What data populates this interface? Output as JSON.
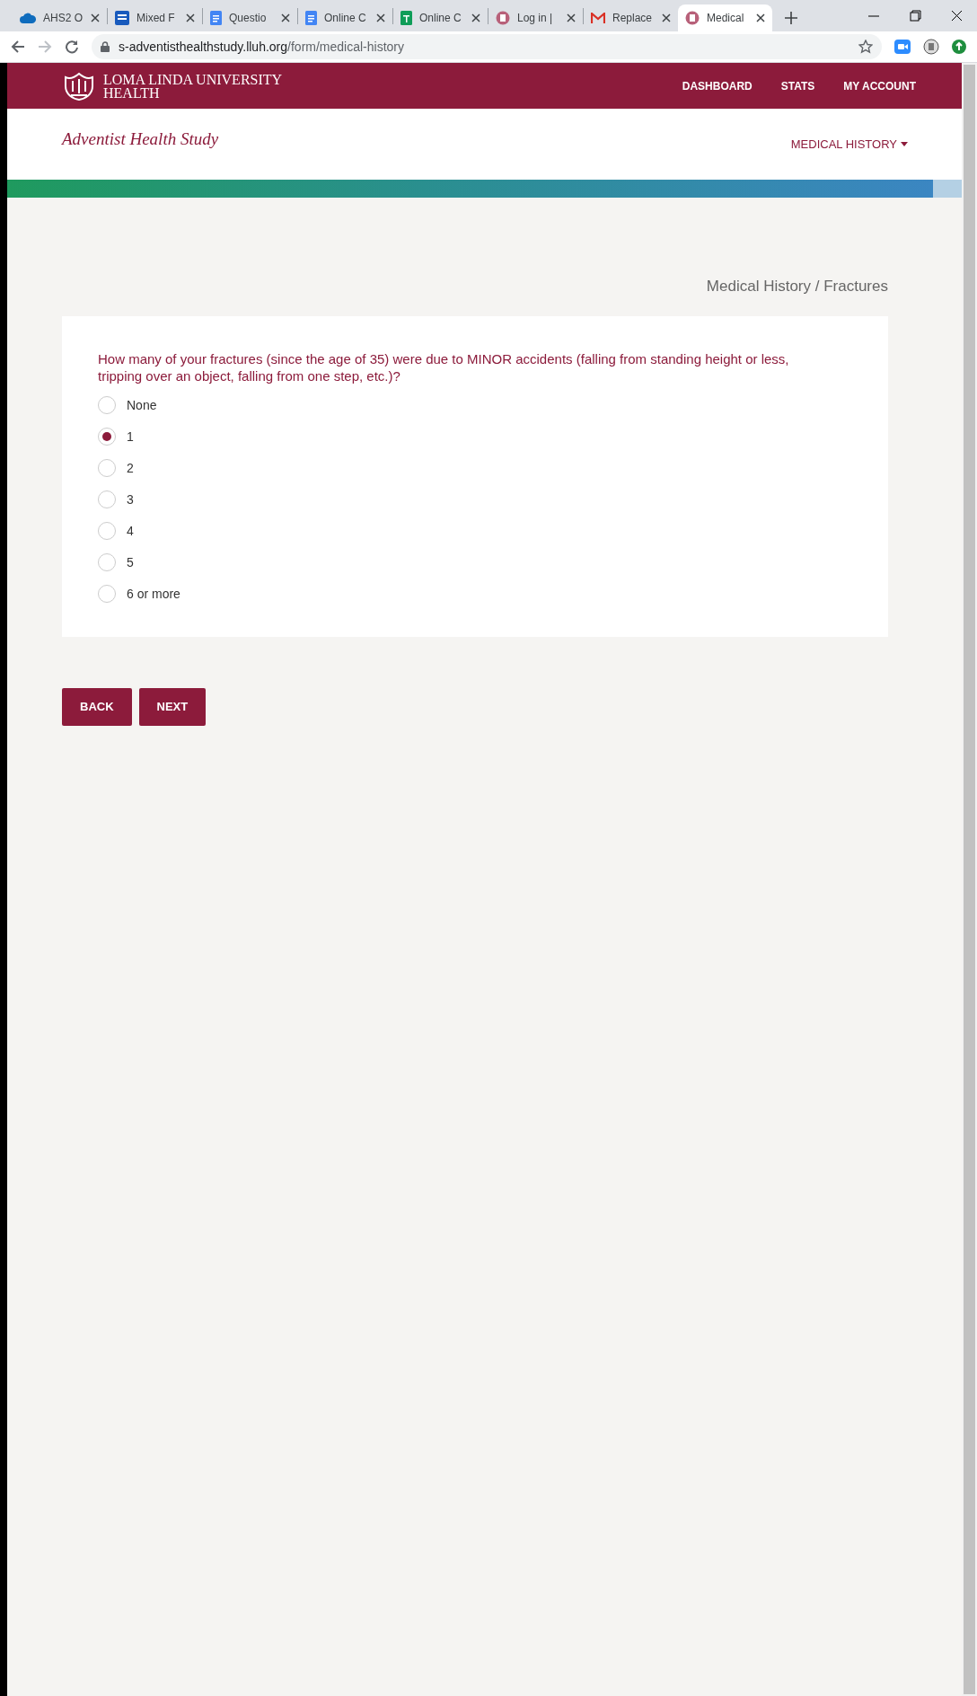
{
  "browser": {
    "tabs": [
      {
        "title": "AHS2 O",
        "kind": "cloud",
        "selected": false
      },
      {
        "title": "Mixed F",
        "kind": "word",
        "selected": false
      },
      {
        "title": "Questio",
        "kind": "doc",
        "selected": false
      },
      {
        "title": "Online C",
        "kind": "doc",
        "selected": false
      },
      {
        "title": "Online C",
        "kind": "sheet",
        "selected": false
      },
      {
        "title": "Log in |",
        "kind": "crest",
        "selected": false
      },
      {
        "title": "Replace",
        "kind": "mail",
        "selected": false
      },
      {
        "title": "Medical",
        "kind": "crest",
        "selected": true
      }
    ],
    "address": {
      "host": "s-adventisthealthstudy.lluh.org",
      "path": "/form/medical-history"
    }
  },
  "header": {
    "logo_lines": [
      "LOMA LINDA UNIVERSITY",
      "HEALTH"
    ],
    "nav": [
      "DASHBOARD",
      "STATS",
      "MY ACCOUNT"
    ]
  },
  "subheader": {
    "title": "Adventist Health Study",
    "menu": "MEDICAL HISTORY"
  },
  "progress": {
    "level": 0.97
  },
  "breadcrumb": "Medical History / Fractures",
  "question": {
    "text": "How many of your fractures (since the age of 35) were due to MINOR accidents (falling from standing height or less, tripping over an object, falling from one step, etc.)?",
    "options": [
      {
        "label": "None",
        "selected": false
      },
      {
        "label": "1",
        "selected": true
      },
      {
        "label": "2",
        "selected": false
      },
      {
        "label": "3",
        "selected": false
      },
      {
        "label": "4",
        "selected": false
      },
      {
        "label": "5",
        "selected": false
      },
      {
        "label": "6 or more",
        "selected": false
      }
    ]
  },
  "buttons": [
    "BACK",
    "NEXT"
  ]
}
